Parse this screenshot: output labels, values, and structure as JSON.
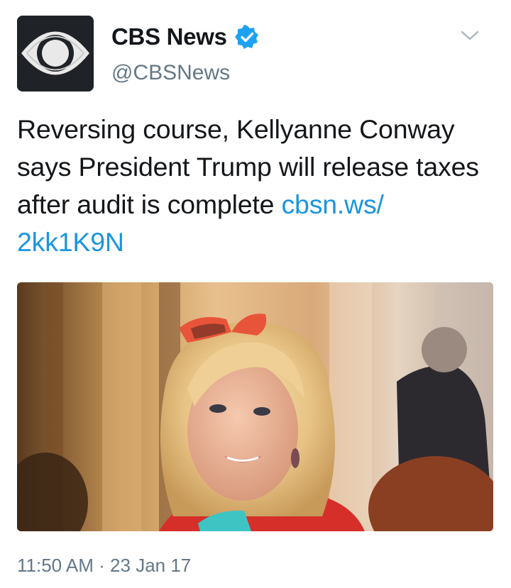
{
  "author": {
    "name": "CBS News",
    "handle": "@CBSNews",
    "avatar_icon": "cbs-eye-logo-icon",
    "verified_icon": "verified-badge-icon",
    "verified_color": "#1da1f2"
  },
  "menu_icon": "chevron-down-icon",
  "tweet": {
    "text": "Reversing course, Kellyanne Conway says President Trump will release taxes after audit is complete ",
    "link_line1": "cbsn.ws/",
    "link_line2": "2kk1K9N",
    "link_color": "#1b95e0"
  },
  "media": {
    "type": "photo",
    "description_icon": "photo"
  },
  "timestamp": {
    "time": "11:50 AM",
    "separator": " · ",
    "date": "23 Jan 17"
  }
}
